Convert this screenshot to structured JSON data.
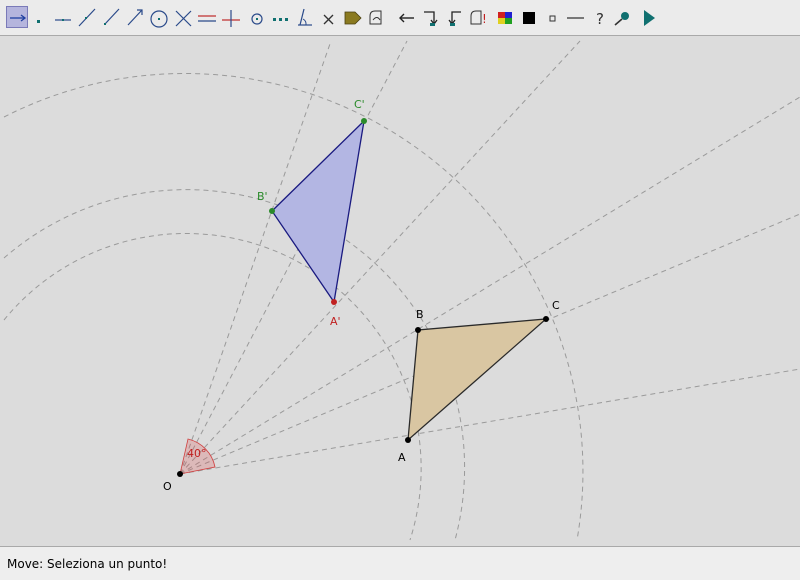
{
  "toolbar": {
    "tools": [
      {
        "name": "move-tool-icon"
      },
      {
        "name": "point-tool-icon"
      },
      {
        "name": "segment-tool-icon"
      },
      {
        "name": "line-tool-icon"
      },
      {
        "name": "ray-tool-icon"
      },
      {
        "name": "vector-tool-icon"
      },
      {
        "name": "circle-tool-icon"
      },
      {
        "name": "intersect-tool-icon"
      },
      {
        "name": "parallel-tool-icon"
      },
      {
        "name": "perpendicular-tool-icon"
      },
      {
        "name": "midpoint-tool-icon"
      },
      {
        "name": "locus-tool-icon"
      },
      {
        "name": "angle-tool-icon"
      },
      {
        "name": "delete-tool-icon"
      },
      {
        "name": "label-tool-icon"
      },
      {
        "name": "macro-tool-icon"
      },
      {
        "name": "undo-arrow-icon"
      },
      {
        "name": "redo-arrow-icon"
      },
      {
        "name": "back-arrow-icon"
      },
      {
        "name": "reset-tool-icon"
      },
      {
        "name": "color-palette-icon"
      },
      {
        "name": "fill-square-icon"
      },
      {
        "name": "point-style-icon"
      },
      {
        "name": "line-style-icon"
      },
      {
        "name": "help-icon"
      },
      {
        "name": "zoom-tool-icon"
      },
      {
        "name": "play-icon"
      }
    ]
  },
  "canvas": {
    "points": {
      "O": "O",
      "A": "A",
      "B": "B",
      "C": "C",
      "A1": "A'",
      "B1": "B'",
      "C1": "C'"
    },
    "angle_label": "40°",
    "colors": {
      "background": "#dcdcdc",
      "construction": "#9a9a9a",
      "triangle_fill": "#d9c6a2",
      "image_fill": "#b3b6e3",
      "image_stroke": "#1a1a80",
      "green_label": "#2a8a2a",
      "red_label": "#c02020",
      "angle_color": "#d04040"
    }
  },
  "status": {
    "message": "Move: Seleziona un punto!"
  }
}
